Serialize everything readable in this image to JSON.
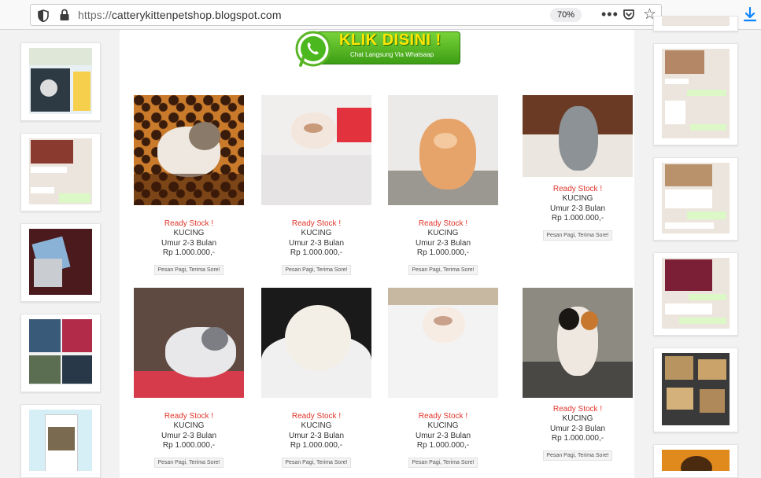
{
  "browser": {
    "url_prefix": "https://",
    "url_domain": "catterykittenpetshop.blogspot.com",
    "zoom": "70%",
    "menu_glyph": "•••",
    "star_glyph": "☆",
    "icons": [
      "shield-icon",
      "lock-icon",
      "pocket-icon",
      "bookmark-star-icon",
      "download-icon"
    ]
  },
  "banner": {
    "title": "KLIK DISINI !",
    "subtitle": "Chat Langsung Via Whatsaap"
  },
  "products": [
    {
      "stock": "Ready Stock !",
      "name": "KUCING",
      "age": "Umur 2-3 Bulan",
      "price": "Rp 1.000.000,-",
      "button": "Pesan Pagi, Terima Sore!"
    },
    {
      "stock": "Ready Stock !",
      "name": "KUCING",
      "age": "Umur 2-3 Bulan",
      "price": "Rp 1.000.000,-",
      "button": "Pesan Pagi, Terima Sore!"
    },
    {
      "stock": "Ready Stock !",
      "name": "KUCING",
      "age": "Umur 2-3 Bulan",
      "price": "Rp 1.000.000,-",
      "button": "Pesan Pagi, Terima Sore!"
    },
    {
      "stock": "Ready Stock !",
      "name": "KUCING",
      "age": "Umur 2-3 Bulan",
      "price": "Rp 1.000.000,-",
      "button": "Pesan Pagi, Terima Sore!"
    },
    {
      "stock": "Ready Stock !",
      "name": "KUCING",
      "age": "Umur 2-3 Bulan",
      "price": "Rp 1.000.000,-",
      "button": "Pesan Pagi, Terima Sore!"
    },
    {
      "stock": "Ready Stock !",
      "name": "KUCING",
      "age": "Umur 2-3 Bulan",
      "price": "Rp 1.000.000,-",
      "button": "Pesan Pagi, Terima Sore!"
    },
    {
      "stock": "Ready Stock !",
      "name": "KUCING",
      "age": "Umur 2-3 Bulan",
      "price": "Rp 1.000.000,-",
      "button": "Pesan Pagi, Terima Sore!"
    },
    {
      "stock": "Ready Stock !",
      "name": "KUCING",
      "age": "Umur 2-3 Bulan",
      "price": "Rp 1.000.000,-",
      "button": "Pesan Pagi, Terima Sore!"
    }
  ],
  "colors": {
    "accent_red": "#e0352b",
    "whatsapp_green": "#3d9e14",
    "banner_yellow": "#ffe600"
  }
}
